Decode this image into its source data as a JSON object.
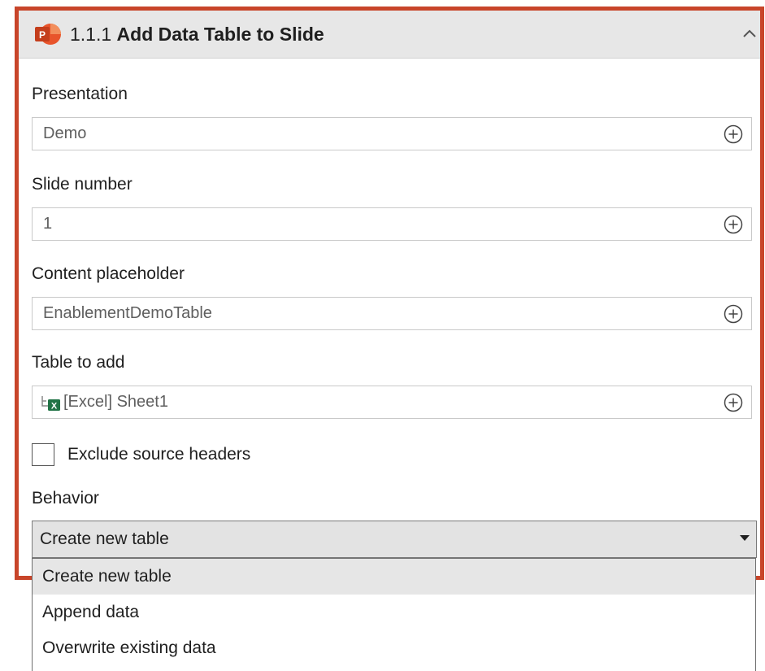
{
  "header": {
    "number": "1.1.1",
    "title": "Add Data Table to Slide",
    "app_icon": "powerpoint-icon",
    "collapse_icon": "chevron-up-icon"
  },
  "fields": {
    "presentation": {
      "label": "Presentation",
      "value": "Demo"
    },
    "slide_number": {
      "label": "Slide number",
      "value": "1"
    },
    "content_placeholder": {
      "label": "Content placeholder",
      "value": "EnablementDemoTable"
    },
    "table_to_add": {
      "label": "Table to add",
      "value": "[Excel] Sheet1",
      "icon": "excel-table-icon"
    }
  },
  "exclude_headers": {
    "label": "Exclude source headers",
    "checked": false
  },
  "behavior": {
    "label": "Behavior",
    "selected": "Create new table",
    "options": [
      "Create new table",
      "Append data",
      "Overwrite existing data"
    ]
  },
  "colors": {
    "card_border": "#c8452a",
    "header_bg": "#e7e7e7",
    "powerpoint": "#d24726",
    "excel": "#217346"
  }
}
